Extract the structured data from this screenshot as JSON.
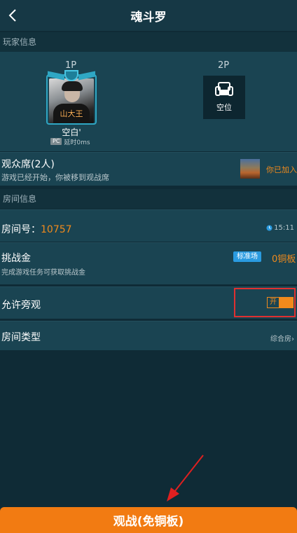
{
  "header": {
    "title": "魂斗罗"
  },
  "sections": {
    "player_info": "玩家信息",
    "room_info": "房间信息"
  },
  "players": {
    "p1": {
      "label": "1P",
      "avatar_caption": "山大王",
      "name": "空白'",
      "platform": "PC",
      "ping": "延时0ms"
    },
    "p2": {
      "label": "2P",
      "empty_label": "空位"
    }
  },
  "spectators": {
    "title": "观众席(2人)",
    "subtitle": "游戏已经开始，你被移到观战席",
    "joined": "你已加入"
  },
  "room": {
    "number_label": "房间号：",
    "number": "10757",
    "time": "15:11",
    "challenge_label": "挑战金",
    "challenge_tag": "标准场",
    "challenge_amount": "0铜板",
    "challenge_sub": "完成游戏任务可获取挑战金",
    "allow_watch_label": "允许旁观",
    "allow_watch_state": "开",
    "room_type_label": "房间类型",
    "room_type_value": "综合房"
  },
  "action": {
    "watch_button": "观战(免铜板)"
  },
  "colors": {
    "accent": "#f08a1c",
    "button": "#f27b12",
    "highlight": "#e03030",
    "tag": "#2a9be0"
  },
  "icons": [
    "back-arrow-icon",
    "sofa-icon",
    "clock-icon",
    "chevron-right-icon"
  ]
}
